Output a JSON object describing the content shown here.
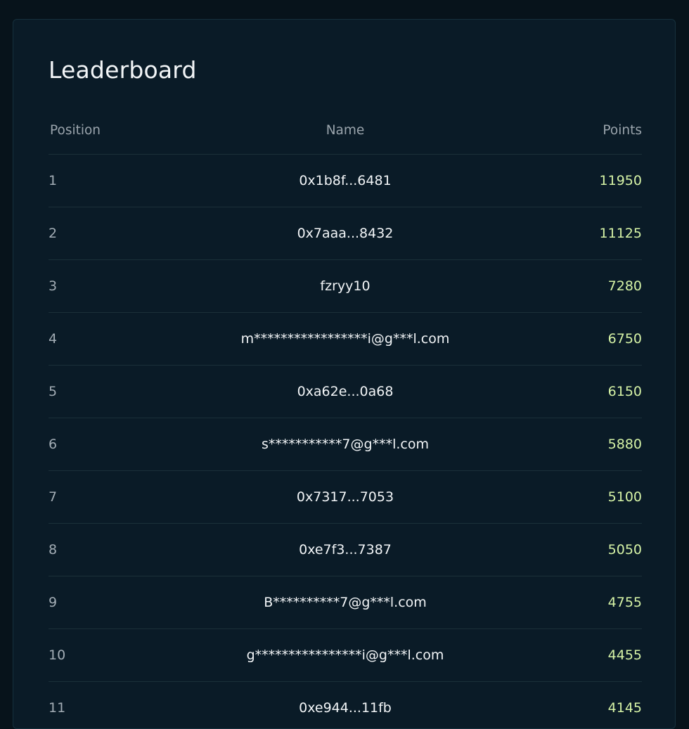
{
  "leaderboard": {
    "title": "Leaderboard",
    "columns": {
      "position": "Position",
      "name": "Name",
      "points": "Points"
    },
    "rows": [
      {
        "position": "1",
        "name": "0x1b8f...6481",
        "points": "11950"
      },
      {
        "position": "2",
        "name": "0x7aaa...8432",
        "points": "11125"
      },
      {
        "position": "3",
        "name": "fzryy10",
        "points": "7280"
      },
      {
        "position": "4",
        "name": "m*****************i@g***l.com",
        "points": "6750"
      },
      {
        "position": "5",
        "name": "0xa62e...0a68",
        "points": "6150"
      },
      {
        "position": "6",
        "name": "s***********7@g***l.com",
        "points": "5880"
      },
      {
        "position": "7",
        "name": "0x7317...7053",
        "points": "5100"
      },
      {
        "position": "8",
        "name": "0xe7f3...7387",
        "points": "5050"
      },
      {
        "position": "9",
        "name": "B**********7@g***l.com",
        "points": "4755"
      },
      {
        "position": "10",
        "name": "g****************i@g***l.com",
        "points": "4455"
      },
      {
        "position": "11",
        "name": "0xe944...11fb",
        "points": "4145"
      }
    ]
  },
  "colors": {
    "background": "#07131b",
    "card": "#0a1b27",
    "points_accent": "#d6f3a6",
    "text_primary": "#f2f5f7",
    "text_muted": "#a3adb5"
  }
}
